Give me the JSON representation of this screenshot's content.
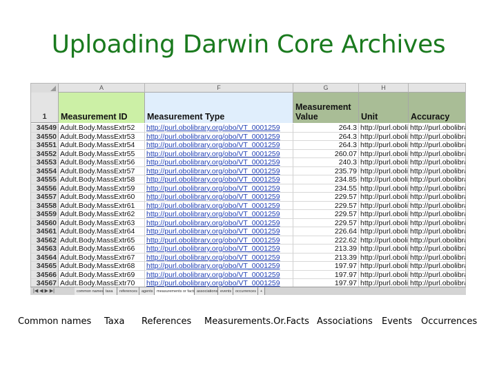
{
  "title": "Uploading Darwin Core Archives",
  "colors": {
    "title": "#1a7a1e",
    "green_header": "#ccf0a6",
    "blue_header": "#e0eefc",
    "olive_header": "#a9bd96",
    "link": "#1f3fb5"
  },
  "sheet": {
    "col_letters": [
      "A",
      "F",
      "G",
      "H"
    ],
    "header_row_num": "1",
    "headers": {
      "measurement_id": "Measurement ID",
      "measurement_type": "Measurement Type",
      "measurement_value": "Measurement Value",
      "unit": "Unit",
      "accuracy": "Accuracy"
    },
    "rows": [
      {
        "n": "34549",
        "id": "Adult.Body.MassExtr52",
        "type": "http://purl.obolibrary.org/obo/VT_0001259",
        "val": "264.3",
        "unit": "http://purl.obolibrary.org/obo/U"
      },
      {
        "n": "34550",
        "id": "Adult.Body.MassExtr53",
        "type": "http://purl.obolibrary.org/obo/VT_0001259",
        "val": "264.3",
        "unit": "http://purl.obolibrary.org/obo/U"
      },
      {
        "n": "34551",
        "id": "Adult.Body.MassExtr54",
        "type": "http://purl.obolibrary.org/obo/VT_0001259",
        "val": "264.3",
        "unit": "http://purl.obolibrary.org/obo/U"
      },
      {
        "n": "34552",
        "id": "Adult.Body.MassExtr55",
        "type": "http://purl.obolibrary.org/obo/VT_0001259",
        "val": "260.07",
        "unit": "http://purl.obolibrary.org/obo/U"
      },
      {
        "n": "34553",
        "id": "Adult.Body.MassExtr56",
        "type": "http://purl.obolibrary.org/obo/VT_0001259",
        "val": "240.3",
        "unit": "http://purl.obolibrary.org/obo/U"
      },
      {
        "n": "34554",
        "id": "Adult.Body.MassExtr57",
        "type": "http://purl.obolibrary.org/obo/VT_0001259",
        "val": "235.79",
        "unit": "http://purl.obolibrary.org/obo/U"
      },
      {
        "n": "34555",
        "id": "Adult.Body.MassExtr58",
        "type": "http://purl.obolibrary.org/obo/VT_0001259",
        "val": "234.85",
        "unit": "http://purl.obolibrary.org/obo/U"
      },
      {
        "n": "34556",
        "id": "Adult.Body.MassExtr59",
        "type": "http://purl.obolibrary.org/obo/VT_0001259",
        "val": "234.55",
        "unit": "http://purl.obolibrary.org/obo/U"
      },
      {
        "n": "34557",
        "id": "Adult.Body.MassExtr60",
        "type": "http://purl.obolibrary.org/obo/VT_0001259",
        "val": "229.57",
        "unit": "http://purl.obolibrary.org/obo/U"
      },
      {
        "n": "34558",
        "id": "Adult.Body.MassExtr61",
        "type": "http://purl.obolibrary.org/obo/VT_0001259",
        "val": "229.57",
        "unit": "http://purl.obolibrary.org/obo/U"
      },
      {
        "n": "34559",
        "id": "Adult.Body.MassExtr62",
        "type": "http://purl.obolibrary.org/obo/VT_0001259",
        "val": "229.57",
        "unit": "http://purl.obolibrary.org/obo/U"
      },
      {
        "n": "34560",
        "id": "Adult.Body.MassExtr63",
        "type": "http://purl.obolibrary.org/obo/VT_0001259",
        "val": "229.57",
        "unit": "http://purl.obolibrary.org/obo/U"
      },
      {
        "n": "34561",
        "id": "Adult.Body.MassExtr64",
        "type": "http://purl.obolibrary.org/obo/VT_0001259",
        "val": "226.64",
        "unit": "http://purl.obolibrary.org/obo/U"
      },
      {
        "n": "34562",
        "id": "Adult.Body.MassExtr65",
        "type": "http://purl.obolibrary.org/obo/VT_0001259",
        "val": "222.62",
        "unit": "http://purl.obolibrary.org/obo/U"
      },
      {
        "n": "34563",
        "id": "Adult.Body.MassExtr66",
        "type": "http://purl.obolibrary.org/obo/VT_0001259",
        "val": "213.39",
        "unit": "http://purl.obolibrary.org/obo/U"
      },
      {
        "n": "34564",
        "id": "Adult.Body.MassExtr67",
        "type": "http://purl.obolibrary.org/obo/VT_0001259",
        "val": "213.39",
        "unit": "http://purl.obolibrary.org/obo/U"
      },
      {
        "n": "34565",
        "id": "Adult.Body.MassExtr68",
        "type": "http://purl.obolibrary.org/obo/VT_0001259",
        "val": "197.97",
        "unit": "http://purl.obolibrary.org/obo/U"
      },
      {
        "n": "34566",
        "id": "Adult.Body.MassExtr69",
        "type": "http://purl.obolibrary.org/obo/VT_0001259",
        "val": "197.97",
        "unit": "http://purl.obolibrary.org/obo/U"
      },
      {
        "n": "34567",
        "id": "Adult.Body.MassExtr70",
        "type": "http://purl.obolibrary.org/obo/VT_0001259",
        "val": "197.97",
        "unit": "http://purl.obolibrary.org/obo/U"
      }
    ],
    "tabs": [
      "common names",
      "taxa",
      "references",
      "agents",
      "measurements or facts",
      "associations",
      "events",
      "occurrences",
      "+"
    ],
    "active_tab_index": 4
  },
  "labels": [
    "Common names",
    "Taxa",
    "References",
    "Measurements.Or.Facts",
    "Associations",
    "Events",
    "Occurrences"
  ]
}
